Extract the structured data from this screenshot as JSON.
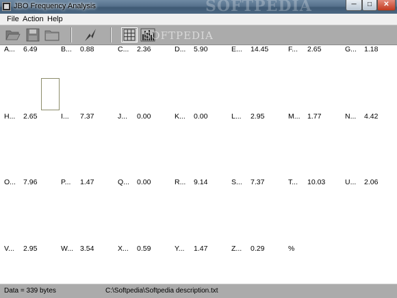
{
  "window": {
    "title": "JBO Frequency Analysis",
    "watermark": "SOFTPEDIA"
  },
  "menu": [
    "File",
    "Action",
    "Help"
  ],
  "toolbar": {
    "buttons": [
      "open-folder-icon",
      "save-disk-icon",
      "folder-icon",
      "lightning-icon",
      "grid-view-icon",
      "bar-chart-icon"
    ],
    "watermark": "SOFTPEDIA"
  },
  "frequencies": [
    {
      "letter": "A",
      "value": "6.49"
    },
    {
      "letter": "B",
      "value": "0.88"
    },
    {
      "letter": "C",
      "value": "2.36"
    },
    {
      "letter": "D",
      "value": "5.90"
    },
    {
      "letter": "E",
      "value": "14.45"
    },
    {
      "letter": "F",
      "value": "2.65"
    },
    {
      "letter": "G",
      "value": "1.18"
    },
    {
      "letter": "H",
      "value": "2.65"
    },
    {
      "letter": "I",
      "value": "7.37"
    },
    {
      "letter": "J",
      "value": "0.00"
    },
    {
      "letter": "K",
      "value": "0.00"
    },
    {
      "letter": "L",
      "value": "2.95"
    },
    {
      "letter": "M",
      "value": "1.77"
    },
    {
      "letter": "N",
      "value": "4.42"
    },
    {
      "letter": "O",
      "value": "7.96"
    },
    {
      "letter": "P",
      "value": "1.47"
    },
    {
      "letter": "Q",
      "value": "0.00"
    },
    {
      "letter": "R",
      "value": "9.14"
    },
    {
      "letter": "S",
      "value": "7.37"
    },
    {
      "letter": "T",
      "value": "10.03"
    },
    {
      "letter": "U",
      "value": "2.06"
    },
    {
      "letter": "V",
      "value": "2.95"
    },
    {
      "letter": "W",
      "value": "3.54"
    },
    {
      "letter": "X",
      "value": "0.59"
    },
    {
      "letter": "Y",
      "value": "1.47"
    },
    {
      "letter": "Z",
      "value": "0.29"
    },
    {
      "letter": "%",
      "value": ""
    }
  ],
  "status": {
    "data_size": "Data = 339 bytes",
    "file_path": "C:\\Softpedia\\Softpedia description.txt"
  }
}
